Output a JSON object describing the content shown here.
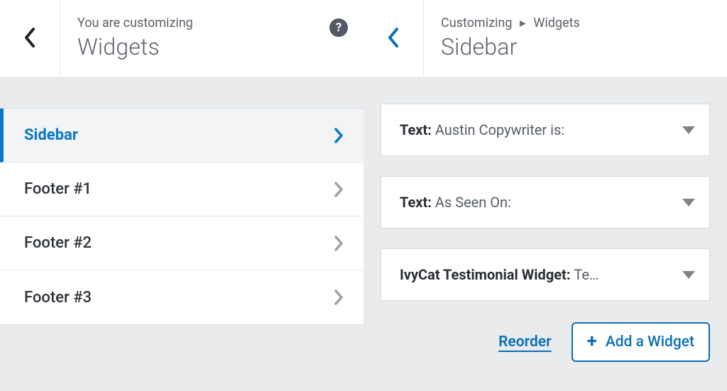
{
  "left": {
    "eyebrow": "You are customizing",
    "title": "Widgets",
    "help_glyph": "?",
    "areas": [
      {
        "label": "Sidebar",
        "active": true
      },
      {
        "label": "Footer #1",
        "active": false
      },
      {
        "label": "Footer #2",
        "active": false
      },
      {
        "label": "Footer #3",
        "active": false
      }
    ]
  },
  "right": {
    "breadcrumb": {
      "parent": "Customizing",
      "current": "Widgets",
      "sep": "▸"
    },
    "title": "Sidebar",
    "widgets": [
      {
        "type": "Text",
        "title": "Austin Copywriter is:"
      },
      {
        "type": "Text",
        "title": "As Seen On:"
      },
      {
        "type": "IvyCat Testimonial Widget",
        "title": "Te…"
      }
    ],
    "reorder": {
      "label": "Reorder"
    },
    "add": {
      "label": "Add a Widget",
      "glyph": "+"
    }
  },
  "colors": {
    "accent": "#0b78c2"
  }
}
